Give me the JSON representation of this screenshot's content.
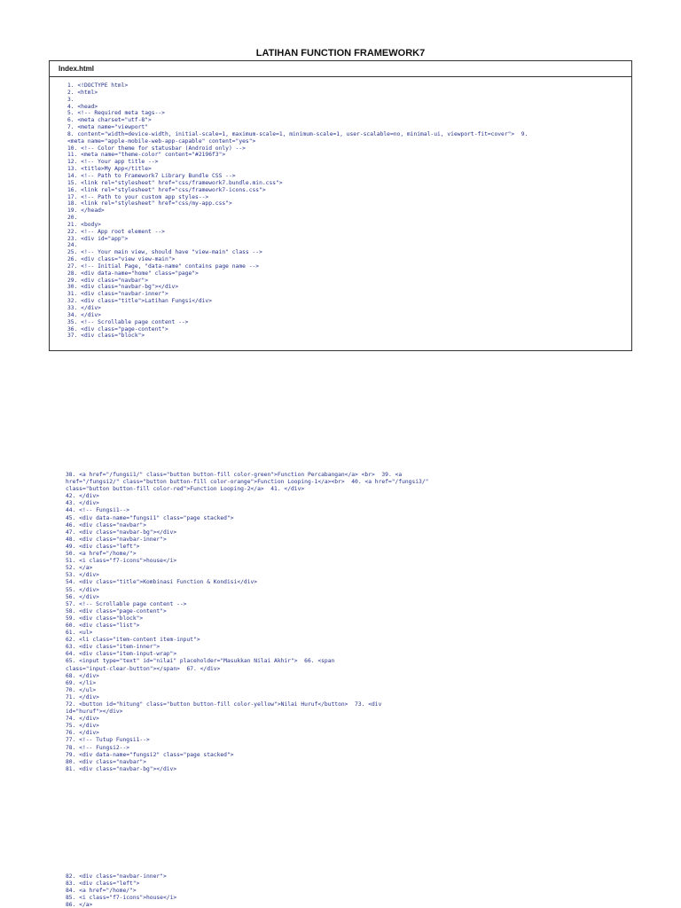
{
  "title": "LATIHAN FUNCTION FRAMEWORK7",
  "file_name": "Index.html",
  "block1": [
    "1. <!DOCTYPE html>",
    "2. <html>",
    "3.",
    "4. <head>",
    "5. <!-- Required meta tags-->",
    "6. <meta charset=\"utf-8\">",
    "7. <meta name=\"viewport\"",
    "8. content=\"width=device-width, initial-scale=1, maximum-scale=1, minimum-scale=1, user-scalable=no, minimal-ui, viewport-fit=cover\">  9.",
    "<meta name=\"apple-mobile-web-app-capable\" content=\"yes\">",
    "10. <!-- Color theme for statusbar (Android only) -->",
    "11. <meta name=\"theme-color\" content=\"#2196f3\">",
    "12. <!-- Your app title -->",
    "13. <title>My App</title>",
    "14. <!-- Path to Framework7 Library Bundle CSS -->",
    "15. <link rel=\"stylesheet\" href=\"css/framework7.bundle.min.css\">",
    "16. <link rel=\"stylesheet\" href=\"css/framework7-icons.css\">",
    "17. <!-- Path to your custom app styles-->",
    "18. <link rel=\"stylesheet\" href=\"css/my-app.css\">",
    "19. </head>",
    "20.",
    "21. <body>",
    "22. <!-- App root element -->",
    "23. <div id=\"app\">",
    "24.",
    "25. <!-- Your main view, should have \"view-main\" class -->",
    "26. <div class=\"view view-main\">",
    "27. <!-- Initial Page, \"data-name\" contains page name -->",
    "28. <div data-name=\"home\" class=\"page\">",
    "29. <div class=\"navbar\">",
    "30. <div class=\"navbar-bg\"></div>",
    "31. <div class=\"navbar-inner\">",
    "32. <div class=\"title\">Latihan Fungsi</div>",
    "33. </div>",
    "34. </div>",
    "35. <!-- Scrollable page content -->",
    "36. <div class=\"page-content\">",
    "37. <div class=\"block\">"
  ],
  "block2": [
    "38. <a href=\"/fungsi1/\" class=\"button button-fill color-green\">Function Percabangan</a> <br>  39. <a",
    "href=\"/fungsi2/\" class=\"button button-fill color-orange\">Function Looping-1</a><br>  40. <a href=\"/fungsi3/\"",
    "class=\"button button-fill color-red\">Function Looping-2</a>  41. </div>",
    "42. </div>",
    "43. </div>",
    "44. <!-- Fungsi1-->",
    "45. <div data-name=\"fungsi1\" class=\"page stacked\">",
    "46. <div class=\"navbar\">",
    "47. <div class=\"navbar-bg\"></div>",
    "48. <div class=\"navbar-inner\">",
    "49. <div class=\"left\">",
    "50. <a href=\"/home/\">",
    "51. <i class=\"f7-icons\">house</i>",
    "52. </a>",
    "53. </div>",
    "54. <div class=\"title\">Kombinasi Function & Kondisi</div>",
    "55. </div>",
    "56. </div>",
    "57. <!-- Scrollable page content -->",
    "58. <div class=\"page-content\">",
    "59. <div class=\"block\">",
    "60. <div class=\"list\">",
    "61. <ul>",
    "62. <li class=\"item-content item-input\">",
    "63. <div class=\"item-inner\">",
    "64. <div class=\"item-input-wrap\">",
    "65. <input type=\"text\" id=\"nilai\" placeholder=\"Masukkan Nilai Akhir\">  66. <span",
    "class=\"input-clear-button\"></span>  67. </div>",
    "68. </div>",
    "69. </li>",
    "70. </ul>",
    "71. </div>",
    "72. <button id=\"hitung\" class=\"button button-fill color-yellow\">Nilai Huruf</button>  73. <div",
    "id=\"huruf\"></div>",
    "74. </div>",
    "75. </div>",
    "76. </div>",
    "77. <!-- Tutup Fungsi1-->",
    "78. <!-- Fungsi2-->",
    "79. <div data-name=\"fungsi2\" class=\"page stacked\">",
    "80. <div class=\"navbar\">",
    "81. <div class=\"navbar-bg\"></div>"
  ],
  "block3": [
    "82. <div class=\"navbar-inner\">",
    "83. <div class=\"left\">",
    "84. <a href=\"/home/\">",
    "85. <i class=\"f7-icons\">house</i>",
    "86. </a>"
  ]
}
